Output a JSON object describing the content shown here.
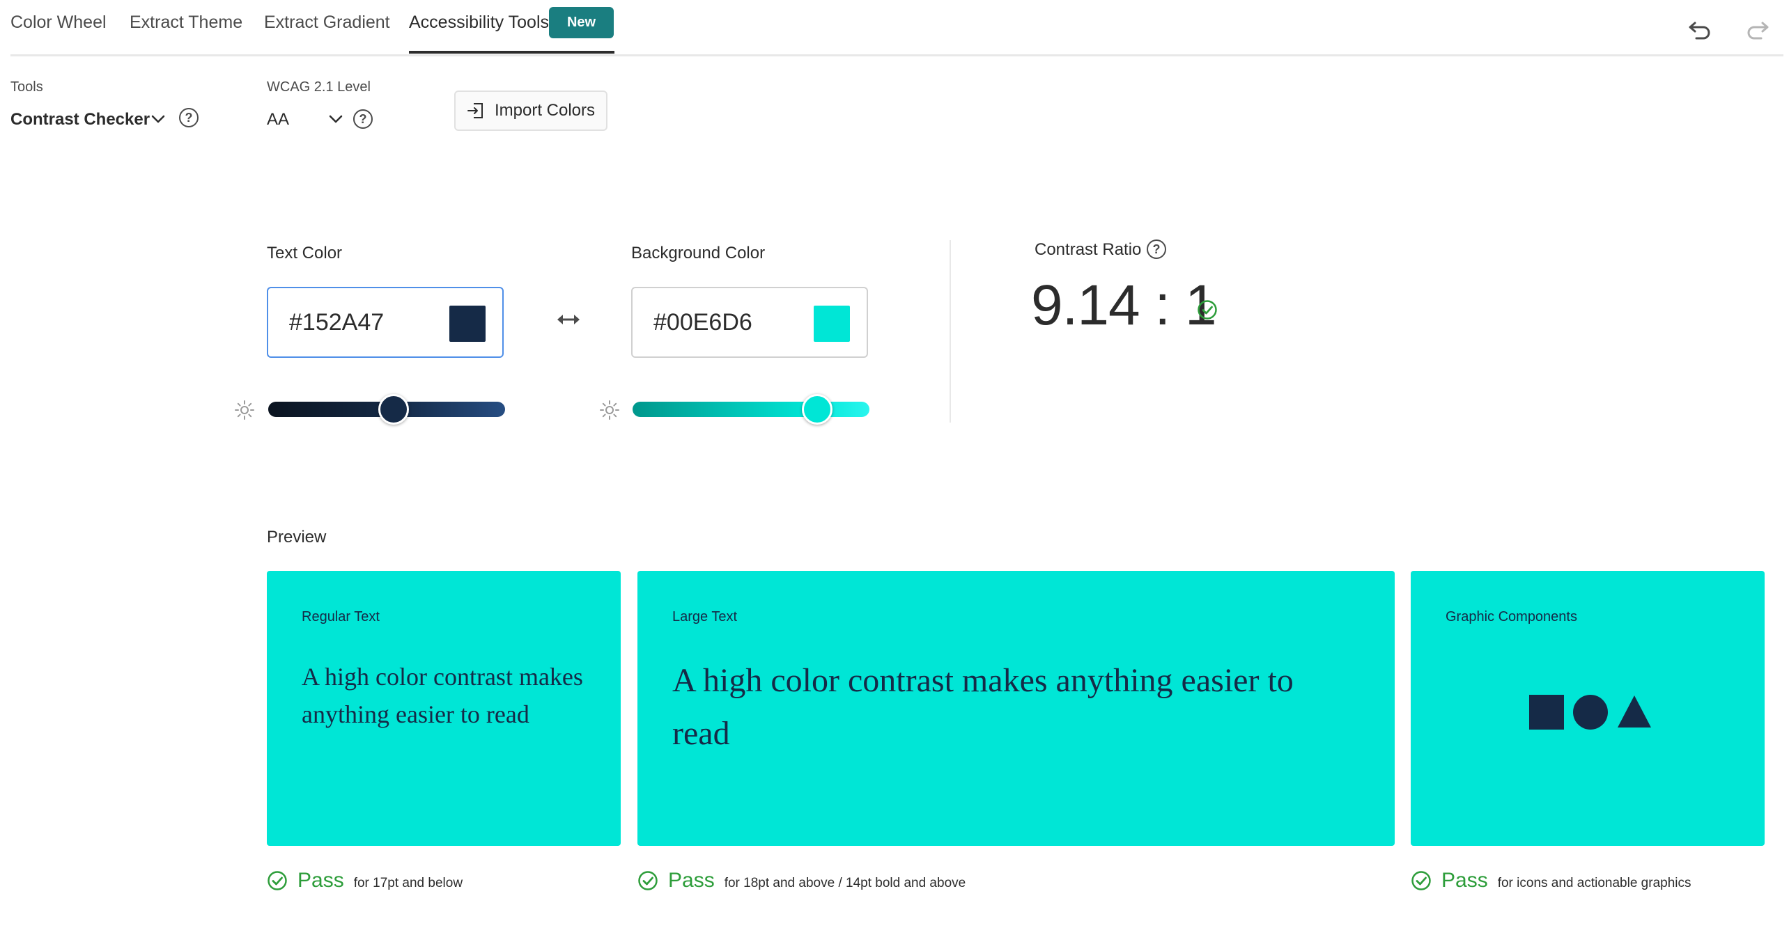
{
  "nav": {
    "tabs": [
      {
        "label": "Color Wheel"
      },
      {
        "label": "Extract Theme"
      },
      {
        "label": "Extract Gradient"
      },
      {
        "label": "Accessibility Tools"
      }
    ],
    "new_badge": "New",
    "undo_icon": "undo-icon",
    "redo_icon": "redo-icon"
  },
  "controls": {
    "tools_label": "Tools",
    "tools_value": "Contrast Checker",
    "wcag_label": "WCAG 2.1 Level",
    "wcag_value": "AA",
    "import_label": "Import Colors"
  },
  "checker": {
    "text_label": "Text Color",
    "text_hex": "#152A47",
    "text_slider_level": 0.53,
    "bg_label": "Background Color",
    "bg_hex": "#00E6D6",
    "bg_slider_level": 0.78,
    "ratio_label": "Contrast Ratio",
    "ratio_value": "9.14 : 1"
  },
  "preview": {
    "label": "Preview",
    "cards": [
      {
        "title": "Regular Text",
        "sample": "A high color contrast makes anything easier to read",
        "result": "Pass",
        "criteria": "for 17pt and below"
      },
      {
        "title": "Large Text",
        "sample": "A high color contrast makes anything easier to read",
        "result": "Pass",
        "criteria": "for 18pt and above / 14pt bold and above"
      },
      {
        "title": "Graphic Components",
        "result": "Pass",
        "criteria": "for icons and actionable graphics"
      }
    ]
  },
  "colors": {
    "text": "#152A47",
    "background": "#00E6D6",
    "pass_green": "#2D9D3A",
    "badge": "#1A7E80"
  }
}
